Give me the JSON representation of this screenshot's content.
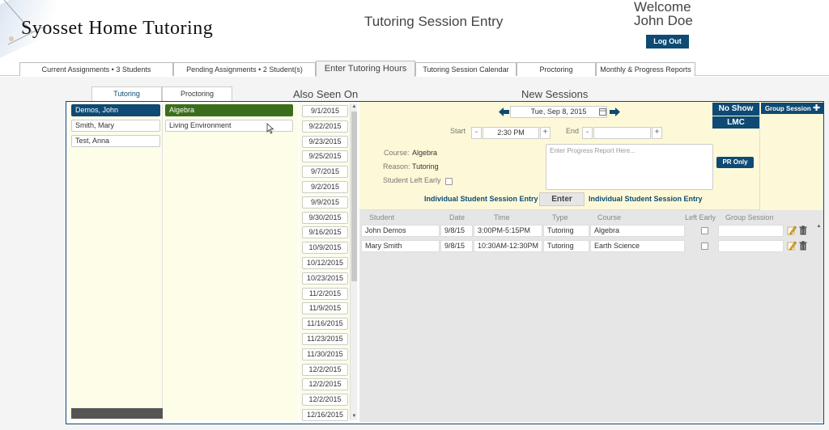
{
  "header": {
    "logo": "Syosset Home Tutoring",
    "page_title": "Tutoring Session Entry",
    "welcome_line1": "Welcome",
    "welcome_line2": "John Doe",
    "logout_label": "Log Out"
  },
  "main_tabs": [
    {
      "label": "Current Assignments • 3 Students"
    },
    {
      "label": "Pending Assignments • 2 Student(s)"
    },
    {
      "label": "Enter Tutoring Hours"
    },
    {
      "label": "Tutoring Session Calendar"
    },
    {
      "label": "Proctoring"
    },
    {
      "label": "Monthly & Progress  Reports"
    }
  ],
  "sub_tabs": [
    {
      "label": "Tutoring"
    },
    {
      "label": "Proctoring"
    }
  ],
  "section_titles": {
    "also_seen_on": "Also Seen On",
    "new_sessions": "New Sessions"
  },
  "students": [
    {
      "name": "Demos, John"
    },
    {
      "name": "Smith, Mary"
    },
    {
      "name": "Test, Anna"
    }
  ],
  "courses": [
    {
      "name": "Algebra"
    },
    {
      "name": "Living Environment"
    }
  ],
  "dates": [
    "9/1/2015",
    "9/22/2015",
    "9/23/2015",
    "9/25/2015",
    "9/7/2015",
    "9/2/2015",
    "9/9/2015",
    "9/30/2015",
    "9/16/2015",
    "10/9/2015",
    "10/12/2015",
    "10/23/2015",
    "11/2/2015",
    "11/9/2015",
    "11/16/2015",
    "11/23/2015",
    "11/30/2015",
    "12/2/2015",
    "12/2/2015",
    "12/2/2015",
    "12/16/2015"
  ],
  "entry": {
    "date_value": "Tue, Sep 8, 2015",
    "start_label": "Start",
    "start_value": "2:30 PM",
    "end_label": "End",
    "end_value": "",
    "course_label": "Course:",
    "course_value": "Algebra",
    "reason_label": "Reason:",
    "reason_value": "Tutoring",
    "left_early_label": "Student Left Early",
    "progress_placeholder": "Enter Progress Report Here...",
    "pr_only_label": "PR Only",
    "individual_entry_left": "Individual Student Session Entry",
    "enter_label": "Enter",
    "individual_entry_right": "Individual Student Session Entry",
    "no_show_label": "No Show",
    "lmc_label": "LMC",
    "group_session_label": "Group Session"
  },
  "grid": {
    "headers": [
      "Student",
      "Date",
      "Time",
      "Type",
      "Course",
      "Left Early",
      "Group Session"
    ],
    "rows": [
      {
        "student": "John  Demos",
        "date": "9/8/15",
        "time": "3:00PM-5:15PM",
        "type": "Tutoring",
        "course": "Algebra"
      },
      {
        "student": "Mary Smith",
        "date": "9/8/15",
        "time": "10:30AM-12:30PM",
        "type": "Tutoring",
        "course": "Earth Science"
      }
    ]
  },
  "colors": {
    "accent": "#0e4a74",
    "selected_course": "#3b6e1c",
    "panel_yellow": "#fdf9d8"
  }
}
